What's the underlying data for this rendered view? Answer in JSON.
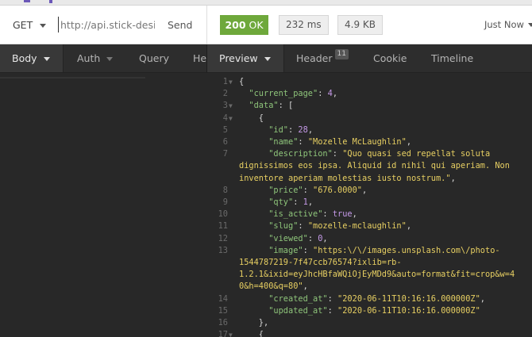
{
  "request": {
    "method": "GET",
    "url": "http://api.stick-design",
    "send_label": "Send"
  },
  "response": {
    "status_code": "200",
    "status_text": "OK",
    "time": "232 ms",
    "size": "4.9 KB",
    "when": "Just Now"
  },
  "request_tabs": [
    {
      "label": "Body"
    },
    {
      "label": "Auth"
    },
    {
      "label": "Query"
    },
    {
      "label": "He"
    }
  ],
  "response_tabs": [
    {
      "label": "Preview"
    },
    {
      "label": "Header",
      "badge": "11"
    },
    {
      "label": "Cookie"
    },
    {
      "label": "Timeline"
    }
  ],
  "lines": [
    {
      "n": "1",
      "fold": true,
      "parts": [
        [
          "p",
          "{"
        ]
      ]
    },
    {
      "n": "2",
      "fold": false,
      "parts": [
        [
          "p",
          "  "
        ],
        [
          "k",
          "\"current_page\""
        ],
        [
          "p",
          ": "
        ],
        [
          "n",
          "4"
        ],
        [
          "p",
          ","
        ]
      ]
    },
    {
      "n": "3",
      "fold": true,
      "parts": [
        [
          "p",
          "  "
        ],
        [
          "k",
          "\"data\""
        ],
        [
          "p",
          ": ["
        ]
      ]
    },
    {
      "n": "4",
      "fold": true,
      "parts": [
        [
          "p",
          "    {"
        ]
      ]
    },
    {
      "n": "5",
      "fold": false,
      "parts": [
        [
          "p",
          "      "
        ],
        [
          "k",
          "\"id\""
        ],
        [
          "p",
          ": "
        ],
        [
          "n",
          "28"
        ],
        [
          "p",
          ","
        ]
      ]
    },
    {
      "n": "6",
      "fold": false,
      "parts": [
        [
          "p",
          "      "
        ],
        [
          "k",
          "\"name\""
        ],
        [
          "p",
          ": "
        ],
        [
          "s",
          "\"Mozelle McLaughlin\""
        ],
        [
          "p",
          ","
        ]
      ]
    },
    {
      "n": "7",
      "fold": false,
      "parts": [
        [
          "p",
          "      "
        ],
        [
          "k",
          "\"description\""
        ],
        [
          "p",
          ": "
        ],
        [
          "s",
          "\"Quo quasi sed repellat soluta"
        ]
      ]
    },
    {
      "n": "",
      "fold": false,
      "parts": [
        [
          "s",
          "dignissimos eos ipsa. Aliquid id nihil qui aperiam. Non"
        ]
      ]
    },
    {
      "n": "",
      "fold": false,
      "parts": [
        [
          "s",
          "inventore aperiam molestias iusto nostrum.\""
        ],
        [
          "p",
          ","
        ]
      ]
    },
    {
      "n": "8",
      "fold": false,
      "parts": [
        [
          "p",
          "      "
        ],
        [
          "k",
          "\"price\""
        ],
        [
          "p",
          ": "
        ],
        [
          "s",
          "\"676.0000\""
        ],
        [
          "p",
          ","
        ]
      ]
    },
    {
      "n": "9",
      "fold": false,
      "parts": [
        [
          "p",
          "      "
        ],
        [
          "k",
          "\"qty\""
        ],
        [
          "p",
          ": "
        ],
        [
          "n",
          "1"
        ],
        [
          "p",
          ","
        ]
      ]
    },
    {
      "n": "10",
      "fold": false,
      "parts": [
        [
          "p",
          "      "
        ],
        [
          "k",
          "\"is_active\""
        ],
        [
          "p",
          ": "
        ],
        [
          "n",
          "true"
        ],
        [
          "p",
          ","
        ]
      ]
    },
    {
      "n": "11",
      "fold": false,
      "parts": [
        [
          "p",
          "      "
        ],
        [
          "k",
          "\"slug\""
        ],
        [
          "p",
          ": "
        ],
        [
          "s",
          "\"mozelle-mclaughlin\""
        ],
        [
          "p",
          ","
        ]
      ]
    },
    {
      "n": "12",
      "fold": false,
      "parts": [
        [
          "p",
          "      "
        ],
        [
          "k",
          "\"viewed\""
        ],
        [
          "p",
          ": "
        ],
        [
          "n",
          "0"
        ],
        [
          "p",
          ","
        ]
      ]
    },
    {
      "n": "13",
      "fold": false,
      "parts": [
        [
          "p",
          "      "
        ],
        [
          "k",
          "\"image\""
        ],
        [
          "p",
          ": "
        ],
        [
          "s",
          "\"https:\\/\\/images.unsplash.com\\/photo-"
        ]
      ]
    },
    {
      "n": "",
      "fold": false,
      "parts": [
        [
          "s",
          "1544787219-7f47ccb76574?ixlib=rb-"
        ]
      ]
    },
    {
      "n": "",
      "fold": false,
      "parts": [
        [
          "s",
          "1.2.1&ixid=eyJhcHBfaWQiOjEyMDd9&auto=format&fit=crop&w=4"
        ]
      ]
    },
    {
      "n": "",
      "fold": false,
      "parts": [
        [
          "s",
          "0&h=400&q=80\""
        ],
        [
          "p",
          ","
        ]
      ]
    },
    {
      "n": "14",
      "fold": false,
      "parts": [
        [
          "p",
          "      "
        ],
        [
          "k",
          "\"created_at\""
        ],
        [
          "p",
          ": "
        ],
        [
          "s",
          "\"2020-06-11T10:16:16.000000Z\""
        ],
        [
          "p",
          ","
        ]
      ]
    },
    {
      "n": "15",
      "fold": false,
      "parts": [
        [
          "p",
          "      "
        ],
        [
          "k",
          "\"updated_at\""
        ],
        [
          "p",
          ": "
        ],
        [
          "s",
          "\"2020-06-11T10:16:16.000000Z\""
        ]
      ]
    },
    {
      "n": "16",
      "fold": false,
      "parts": [
        [
          "p",
          "    },"
        ]
      ]
    },
    {
      "n": "17",
      "fold": true,
      "parts": [
        [
          "p",
          "    {"
        ]
      ]
    }
  ]
}
